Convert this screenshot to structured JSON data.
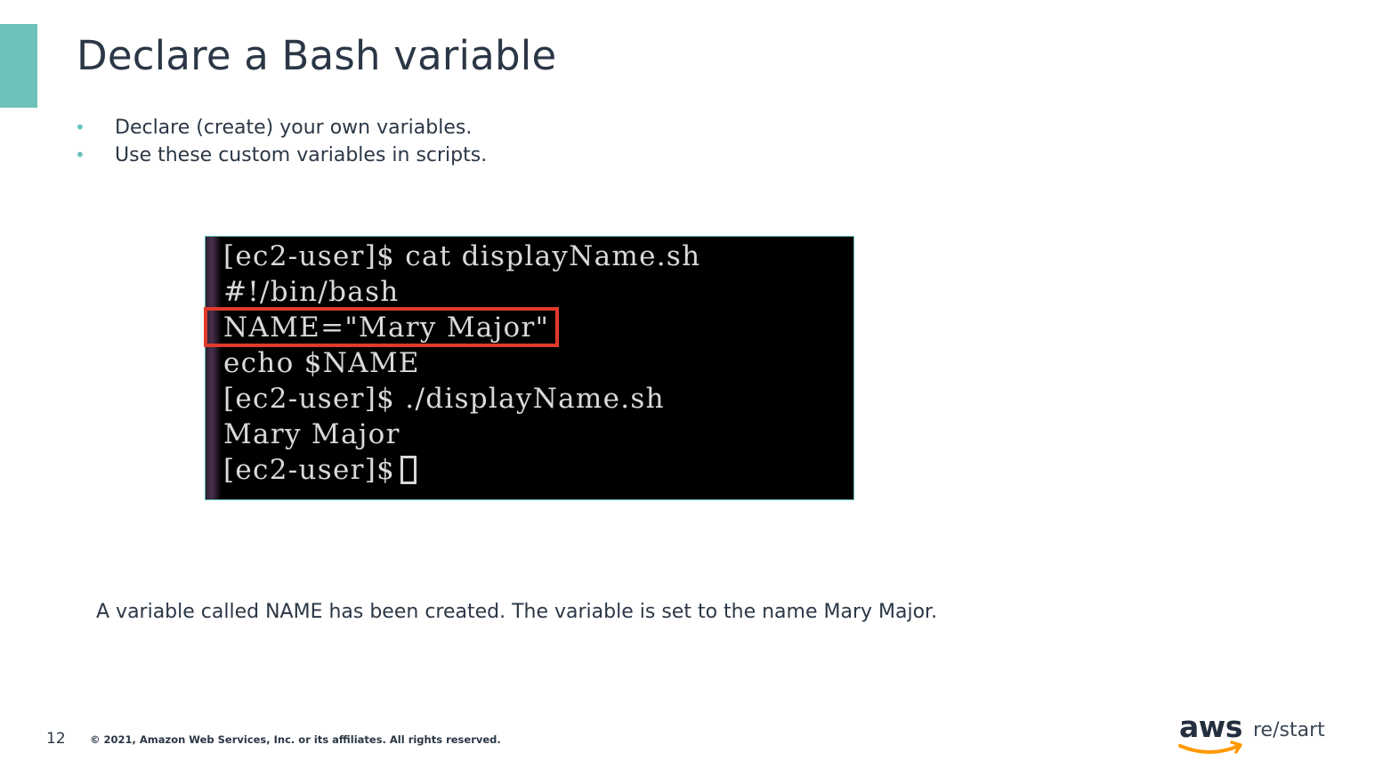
{
  "slide": {
    "title": "Declare a Bash variable",
    "bullets": [
      "Declare (create) your own variables.",
      "Use these custom variables in scripts."
    ],
    "bullet_glyph": "•",
    "caption": "A variable called NAME has been created. The variable is set to the name Mary Major.",
    "accent_color": "#6cc2b8"
  },
  "terminal": {
    "lines": [
      "[ec2-user]$ cat displayName.sh",
      "#!/bin/bash",
      "NAME=\"Mary Major\"",
      "echo $NAME",
      "[ec2-user]$ ./displayName.sh",
      "Mary Major",
      "[ec2-user]$"
    ],
    "highlight_color": "#e03a2b"
  },
  "footer": {
    "page_number": "12",
    "copyright": "© 2021, Amazon Web Services, Inc. or its affiliates. All rights reserved."
  },
  "logo": {
    "wordmark": "aws",
    "product": "re/start",
    "icon": "aws-smile-arrow-icon"
  }
}
